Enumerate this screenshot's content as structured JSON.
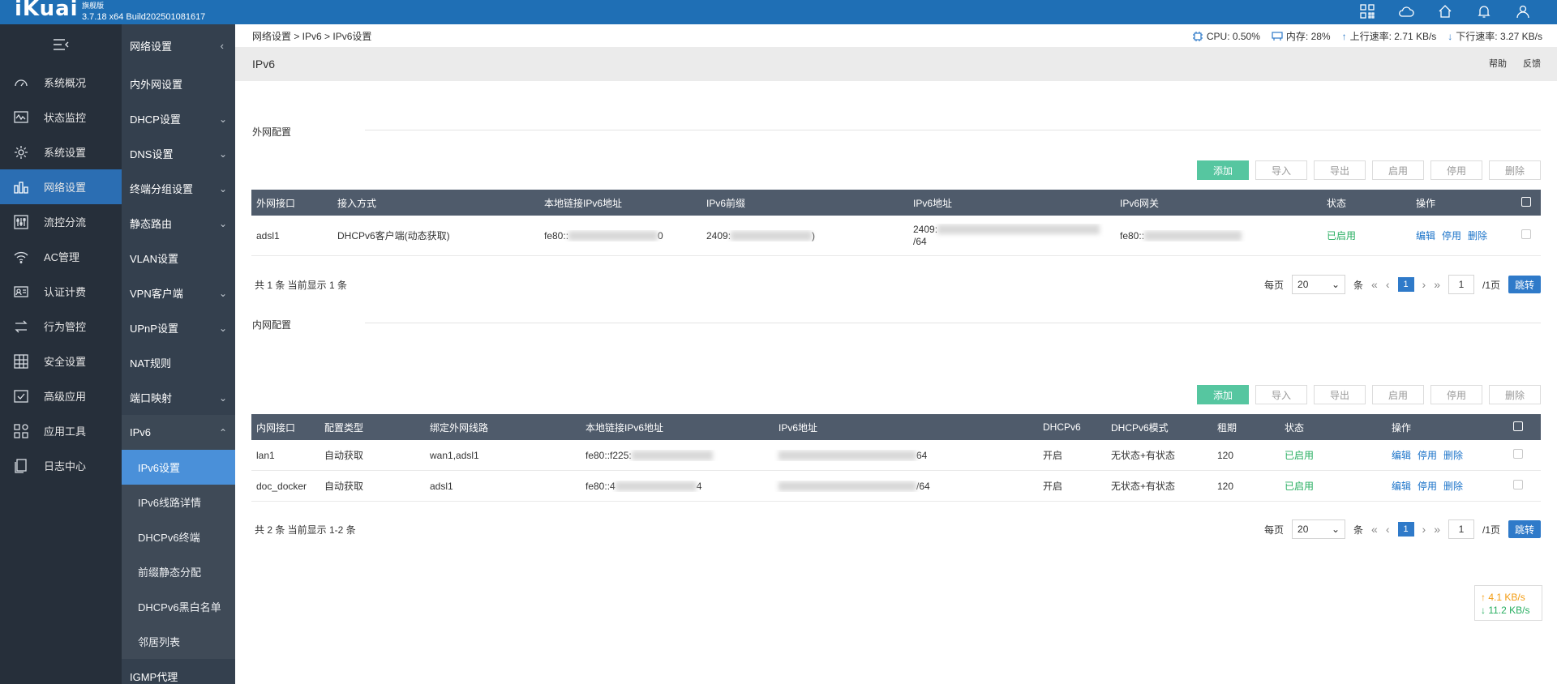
{
  "app": {
    "logo": "iKuai",
    "edition": "旗舰版",
    "version": "3.7.18 x64 Build202501081617"
  },
  "topbar_icons": [
    "apps-icon",
    "cloud-icon",
    "home-icon",
    "bell-icon",
    "user-icon"
  ],
  "left_nav": [
    {
      "label": "系统概况",
      "icon": "dashboard-icon"
    },
    {
      "label": "状态监控",
      "icon": "monitor-icon"
    },
    {
      "label": "系统设置",
      "icon": "gear-icon"
    },
    {
      "label": "网络设置",
      "icon": "network-icon",
      "active": true
    },
    {
      "label": "流控分流",
      "icon": "sliders-icon"
    },
    {
      "label": "AC管理",
      "icon": "wifi-icon"
    },
    {
      "label": "认证计费",
      "icon": "idcard-icon"
    },
    {
      "label": "行为管控",
      "icon": "arrows-icon"
    },
    {
      "label": "安全设置",
      "icon": "grid-icon"
    },
    {
      "label": "高级应用",
      "icon": "check-square-icon"
    },
    {
      "label": "应用工具",
      "icon": "tools-icon"
    },
    {
      "label": "日志中心",
      "icon": "doc-icon"
    }
  ],
  "sub_nav": {
    "title": "网络设置",
    "items": [
      {
        "label": "内外网设置",
        "expand": false
      },
      {
        "label": "DHCP设置",
        "expand": true
      },
      {
        "label": "DNS设置",
        "expand": true
      },
      {
        "label": "终端分组设置",
        "expand": true
      },
      {
        "label": "静态路由",
        "expand": true
      },
      {
        "label": "VLAN设置",
        "expand": false
      },
      {
        "label": "VPN客户端",
        "expand": true
      },
      {
        "label": "UPnP设置",
        "expand": true
      },
      {
        "label": "NAT规则",
        "expand": false
      },
      {
        "label": "端口映射",
        "expand": true
      },
      {
        "label": "IPv6",
        "expand": true,
        "open": true
      }
    ],
    "children": [
      {
        "label": "IPv6设置",
        "active": true
      },
      {
        "label": "IPv6线路详情"
      },
      {
        "label": "DHCPv6终端"
      },
      {
        "label": "前缀静态分配"
      },
      {
        "label": "DHCPv6黑白名单"
      },
      {
        "label": "邻居列表"
      }
    ],
    "after": {
      "label": "IGMP代理"
    }
  },
  "breadcrumb": "网络设置 > IPv6 > IPv6设置",
  "stats": {
    "cpu": "CPU: 0.50%",
    "mem": "内存: 28%",
    "up": "上行速率: 2.71 KB/s",
    "down": "下行速率: 3.27 KB/s"
  },
  "page_title": "IPv6",
  "title_links": {
    "help": "帮助",
    "feedback": "反馈"
  },
  "buttons": {
    "add": "添加",
    "import": "导入",
    "export": "导出",
    "enable": "启用",
    "disable": "停用",
    "delete": "删除"
  },
  "wan": {
    "title": "外网配置",
    "headers": [
      "外网接口",
      "接入方式",
      "本地链接IPv6地址",
      "IPv6前缀",
      "IPv6地址",
      "IPv6网关",
      "状态",
      "操作"
    ],
    "rows": [
      {
        "iface": "adsl1",
        "mode": "DHCPv6客户端(动态获取)",
        "link_local": "fe80::",
        "link_local_tail": "0",
        "prefix": "2409:",
        "prefix_tail": ")",
        "addr1": "2409:",
        "addr2": "/64",
        "gateway": "fe80::",
        "status": "已启用",
        "ops": [
          "编辑",
          "停用",
          "删除"
        ]
      }
    ],
    "summary": "共 1 条 当前显示 1 条"
  },
  "lan": {
    "title": "内网配置",
    "headers": [
      "内网接口",
      "配置类型",
      "绑定外网线路",
      "本地链接IPv6地址",
      "IPv6地址",
      "DHCPv6",
      "DHCPv6模式",
      "租期",
      "状态",
      "操作"
    ],
    "rows": [
      {
        "iface": "lan1",
        "type": "自动获取",
        "bind": "wan1,adsl1",
        "link_local": "fe80::f225:",
        "addr_tail": "64",
        "dhcpv6": "开启",
        "mode": "无状态+有状态",
        "lease": "120",
        "status": "已启用",
        "ops": [
          "编辑",
          "停用",
          "删除"
        ]
      },
      {
        "iface": "doc_docker",
        "type": "自动获取",
        "bind": "adsl1",
        "link_local": "fe80::4",
        "link_local_tail": "4",
        "addr_tail": "/64",
        "dhcpv6": "开启",
        "mode": "无状态+有状态",
        "lease": "120",
        "status": "已启用",
        "ops": [
          "编辑",
          "停用",
          "删除"
        ]
      }
    ],
    "summary": "共 2 条 当前显示 1-2 条"
  },
  "pager": {
    "per_page_label": "每页",
    "per_page": "20",
    "unit": "条",
    "current": "1",
    "page_input": "1",
    "total": "/1页",
    "jump": "跳转"
  },
  "speed": {
    "up": "↑ 4.1 KB/s",
    "down": "↓ 11.2 KB/s"
  },
  "colors": {
    "topbar": "#1f6fb5",
    "nav_active": "#2b6eb3",
    "sub_active": "#4a90d9",
    "add_button": "#56c6a0",
    "table_header": "#4f5b6b",
    "enabled": "#27ae60",
    "link": "#1b73c9"
  }
}
